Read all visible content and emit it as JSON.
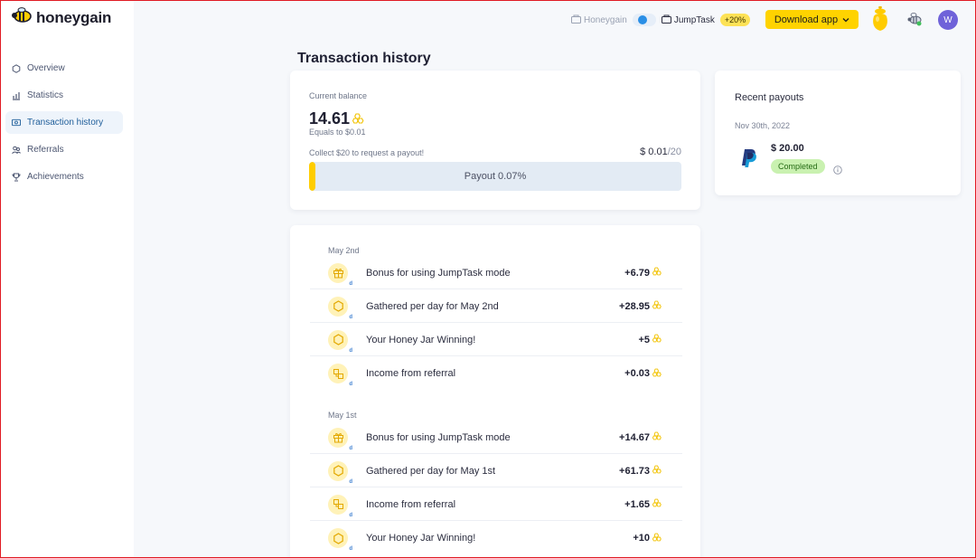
{
  "app": {
    "logo_text": "honeygain"
  },
  "sidebar": {
    "items": [
      {
        "label": "Overview",
        "icon": "hexagon-icon",
        "active": false
      },
      {
        "label": "Statistics",
        "icon": "chart-icon",
        "active": false
      },
      {
        "label": "Transaction history",
        "icon": "banknote-icon",
        "active": true
      },
      {
        "label": "Referrals",
        "icon": "people-icon",
        "active": false
      },
      {
        "label": "Achievements",
        "icon": "trophy-icon",
        "active": false
      }
    ]
  },
  "topbar": {
    "mode_honeygain": "Honeygain",
    "mode_jumptask": "JumpTask",
    "jumptask_bonus": "+20%",
    "download_label": "Download app",
    "avatar_initial": "W"
  },
  "page": {
    "title": "Transaction history"
  },
  "balance": {
    "label": "Current balance",
    "value": "14.61",
    "equals": "Equals to $0.01",
    "collect_text": "Collect $20 to request a payout!",
    "progress_current": "$ 0.01",
    "progress_target": "/20",
    "progress_label": "Payout 0.07%",
    "progress_fraction": 0.0007
  },
  "payouts": {
    "title": "Recent payouts",
    "date": "Nov 30th, 2022",
    "amount": "$ 20.00",
    "status": "Completed"
  },
  "transactions": {
    "groups": [
      {
        "date": "May 2nd",
        "items": [
          {
            "icon": "gift-icon",
            "label": "Bonus for using JumpTask mode",
            "amount": "+6.79"
          },
          {
            "icon": "hexagon-coin-icon",
            "label": "Gathered per day for May 2nd",
            "amount": "+28.95"
          },
          {
            "icon": "hexagon-coin-icon",
            "label": "Your Honey Jar Winning!",
            "amount": "+5"
          },
          {
            "icon": "referral-icon",
            "label": "Income from referral",
            "amount": "+0.03"
          }
        ]
      },
      {
        "date": "May 1st",
        "items": [
          {
            "icon": "gift-icon",
            "label": "Bonus for using JumpTask mode",
            "amount": "+14.67"
          },
          {
            "icon": "hexagon-coin-icon",
            "label": "Gathered per day for May 1st",
            "amount": "+61.73"
          },
          {
            "icon": "referral-icon",
            "label": "Income from referral",
            "amount": "+1.65"
          },
          {
            "icon": "hexagon-coin-icon",
            "label": "Your Honey Jar Winning!",
            "amount": "+10"
          }
        ]
      }
    ],
    "sub_mark": "d"
  },
  "colors": {
    "accent": "#ffd300",
    "brand_blue": "#2a8fe6",
    "completed_bg": "#c9f1b0"
  }
}
